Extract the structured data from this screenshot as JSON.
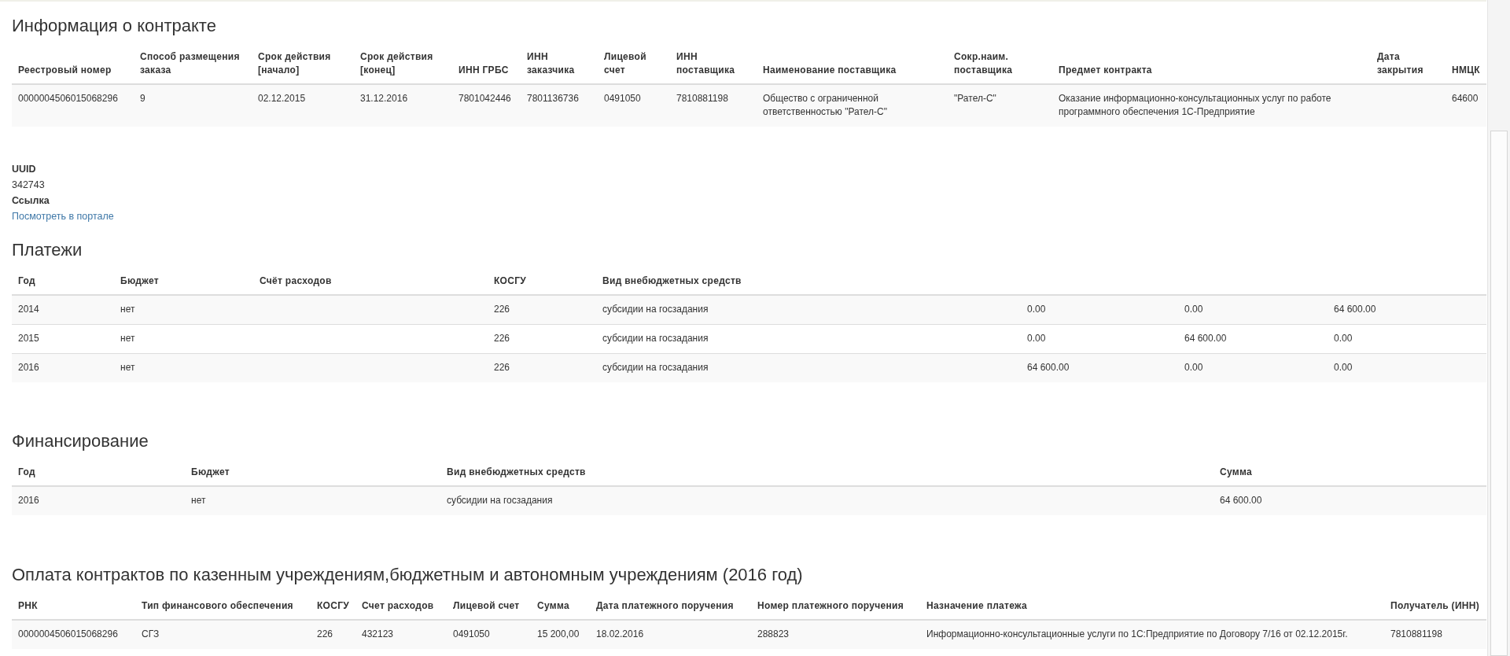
{
  "contract_info": {
    "title": "Информация о контракте",
    "table": {
      "columns": [
        "Реестровый номер",
        "Способ размещения заказа",
        "Срок действия [начало]",
        "Срок действия [конец]",
        "ИНН ГРБС",
        "ИНН заказчика",
        "Лицевой счет",
        "ИНН поставщика",
        "Наименование поставщика",
        "Сокр.наим. поставщика",
        "Предмет контракта",
        "Дата закрытия",
        "НМЦК"
      ],
      "rows": [
        [
          "0000004506015068296",
          "9",
          "02.12.2015",
          "31.12.2016",
          "7801042446",
          "7801136736",
          "0491050",
          "7810881198",
          "Общество с ограниченной ответственностью \"Рател-С\"",
          "\"Рател-С\"",
          "Оказание информационно-консультационных услуг по работе программного обеспечения 1С-Предприятие",
          "",
          "64600"
        ]
      ]
    },
    "uuid_label": "UUID",
    "uuid": "342743",
    "link_label": "Ссылка",
    "link": "Посмотреть в портале"
  },
  "payments": {
    "title": "Платежи",
    "table": {
      "columns": [
        "Год",
        "Бюджет",
        "Счёт расходов",
        "КОСГУ",
        "Вид внебюджетных средств"
      ],
      "rows": [
        [
          "2014",
          "нет",
          "",
          "226",
          "субсидии на госзадания",
          "0.00",
          "0.00",
          "64 600.00"
        ],
        [
          "2015",
          "нет",
          "",
          "226",
          "субсидии на госзадания",
          "0.00",
          "64 600.00",
          "0.00"
        ],
        [
          "2016",
          "нет",
          "",
          "226",
          "субсидии на госзадания",
          "64 600.00",
          "0.00",
          "0.00"
        ]
      ]
    }
  },
  "financing": {
    "title": "Финансирование",
    "table": {
      "columns": [
        "Год",
        "Бюджет",
        "Вид внебюджетных средств",
        "Сумма"
      ],
      "rows": [
        [
          "2016",
          "нет",
          "субсидии на госзадания",
          "64 600.00"
        ]
      ]
    }
  },
  "contract_payments": {
    "title": "Оплата контрактов по казенным учреждениям,бюджетным и автономным учреждениям (2016 год)",
    "table": {
      "columns": [
        "РНК",
        "Тип финансового обеспечения",
        "КОСГУ",
        "Счет расходов",
        "Лицевой счет",
        "Сумма",
        "Дата платежного поручения",
        "Номер платежного поручения",
        "Назначение платежа",
        "Получатель (ИНН)"
      ],
      "rows": [
        [
          "0000004506015068296",
          "СГЗ",
          "226",
          "432123",
          "0491050",
          "15 200,00",
          "18.02.2016",
          "288823",
          "Информационно-консультационные услуги по 1С:Предприятие по Договору 7/16 от 02.12.2015г.",
          "7810881198"
        ]
      ]
    }
  }
}
